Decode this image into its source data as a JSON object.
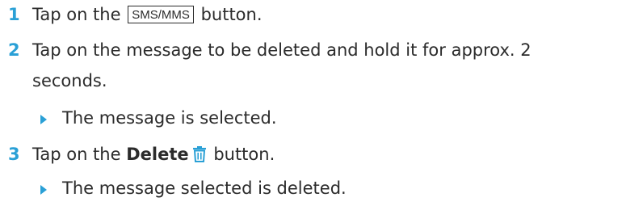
{
  "steps": [
    {
      "number": "1",
      "prefix": "Tap on the",
      "button_key": "SMS/MMS",
      "suffix": "button."
    },
    {
      "number": "2",
      "line1": "Tap on the message to be deleted and hold it for approx. 2",
      "line2": "seconds.",
      "result": "The message is selected."
    },
    {
      "number": "3",
      "prefix": "Tap on the",
      "button_bold": "Delete",
      "button_icon": "trash-icon",
      "suffix": "button.",
      "result": "The message selected is deleted."
    }
  ],
  "colors": {
    "accent": "#2aa0d6",
    "text": "#2b2b2b"
  }
}
